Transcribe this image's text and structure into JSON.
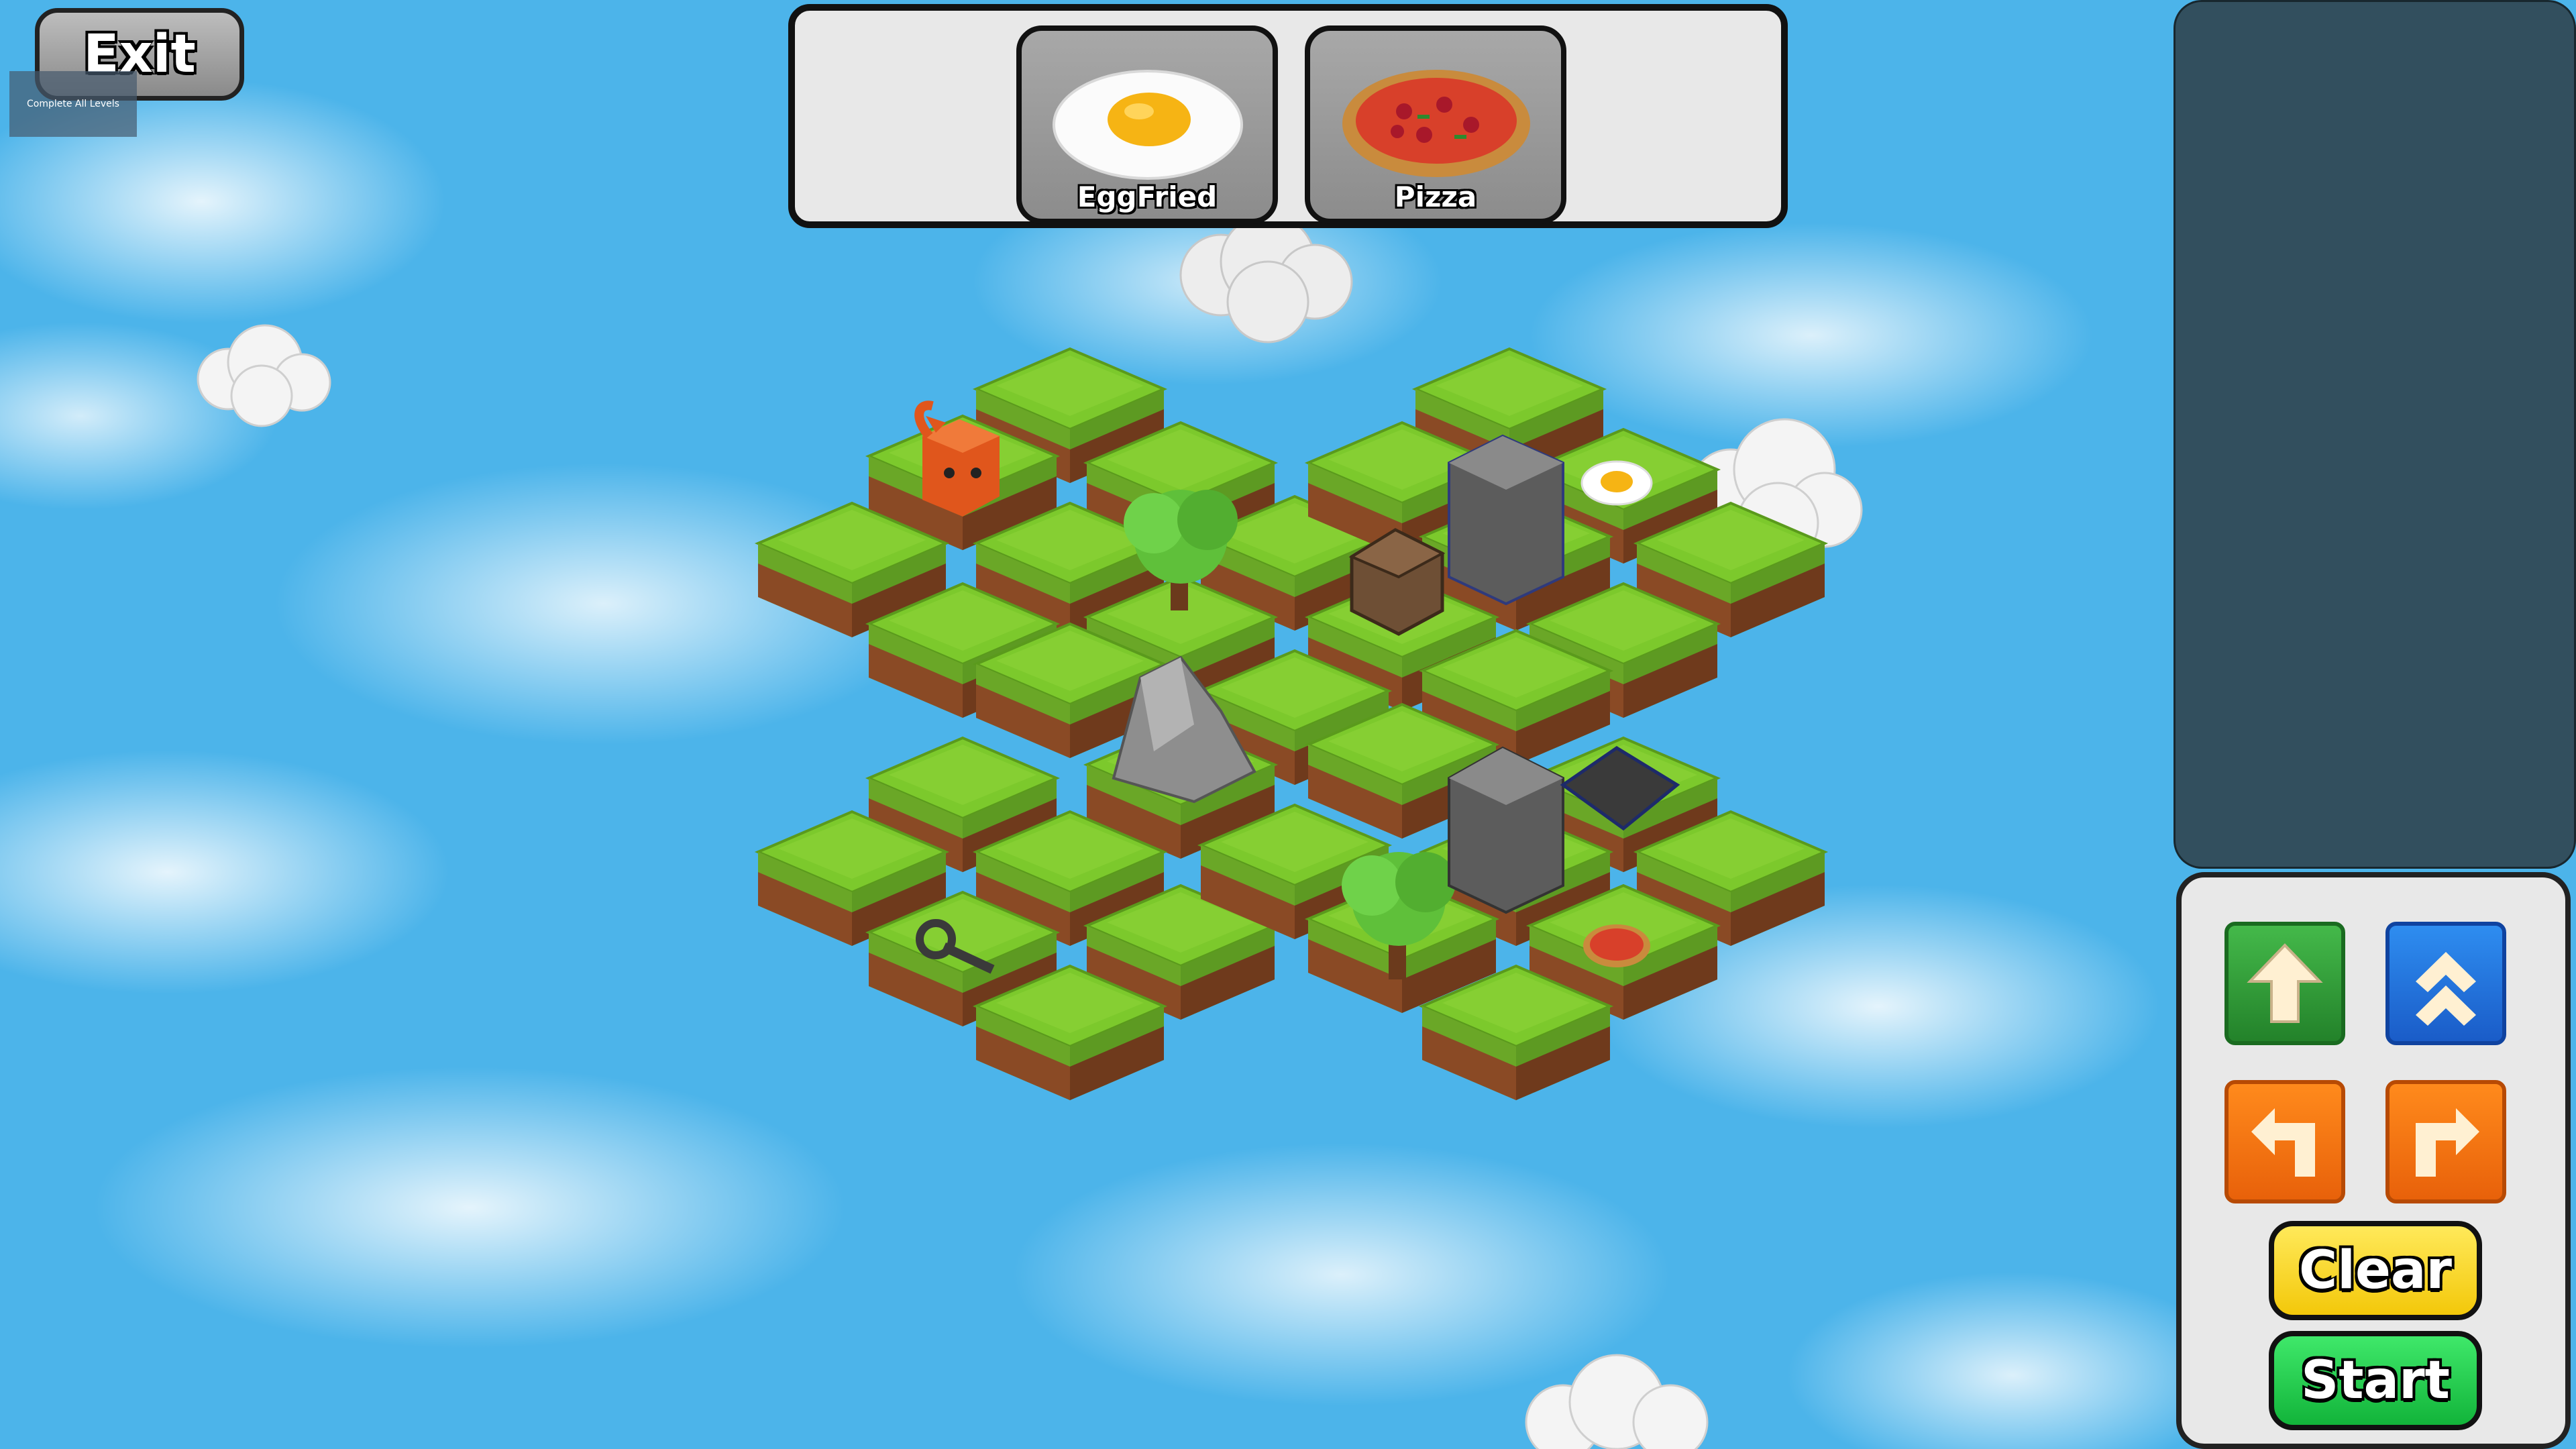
{
  "game": {
    "exit_label": "Exit",
    "progress_text": "Complete All Levels",
    "goals": [
      {
        "label": "EggFried",
        "icon": "fried-egg-icon"
      },
      {
        "label": "Pizza",
        "icon": "pizza-icon"
      }
    ],
    "controls": {
      "forward": "arrow-up-icon",
      "jump": "double-chevron-up-icon",
      "turn_left": "turn-left-arrow-icon",
      "turn_right": "turn-right-arrow-icon",
      "clear_label": "Clear",
      "start_label": "Start"
    },
    "board_objects": [
      "player-cat",
      "tree",
      "tree",
      "rock",
      "crate",
      "stone-pillar",
      "stone-pillar",
      "pressure-plate",
      "key",
      "fried-egg",
      "pizza"
    ],
    "colors": {
      "sky": "#4cb4ea",
      "grass": "#7cc92c",
      "dirt": "#8a4a25",
      "start": "#12b43a",
      "clear": "#f3c80a"
    }
  }
}
